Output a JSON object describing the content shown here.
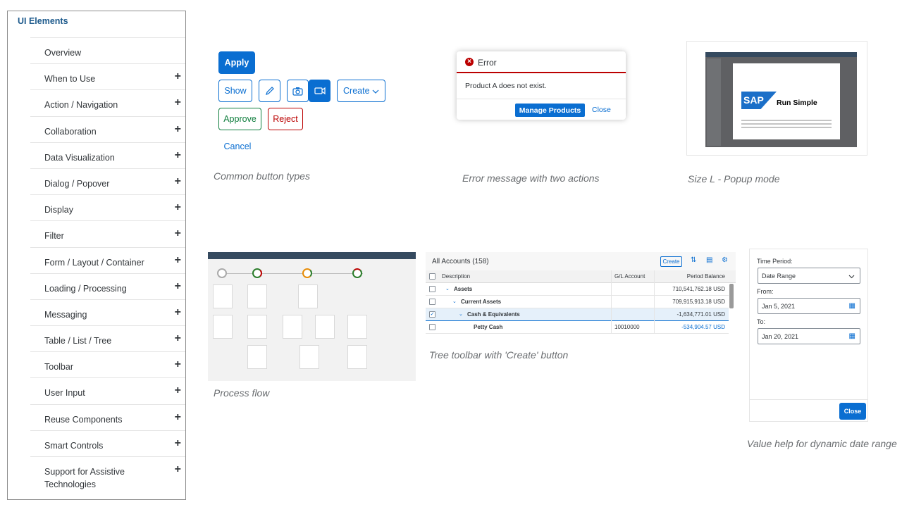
{
  "sidebar": {
    "title": "UI Elements",
    "items": [
      {
        "label": "Overview",
        "expandable": false
      },
      {
        "label": "When to Use",
        "expandable": true
      },
      {
        "label": "Action / Navigation",
        "expandable": true
      },
      {
        "label": "Collaboration",
        "expandable": true
      },
      {
        "label": "Data Visualization",
        "expandable": true
      },
      {
        "label": "Dialog / Popover",
        "expandable": true
      },
      {
        "label": "Display",
        "expandable": true
      },
      {
        "label": "Filter",
        "expandable": true
      },
      {
        "label": "Form / Layout / Container",
        "expandable": true
      },
      {
        "label": "Loading / Processing",
        "expandable": true
      },
      {
        "label": "Messaging",
        "expandable": true
      },
      {
        "label": "Table / List / Tree",
        "expandable": true
      },
      {
        "label": "Toolbar",
        "expandable": true
      },
      {
        "label": "User Input",
        "expandable": true
      },
      {
        "label": "Reuse Components",
        "expandable": true
      },
      {
        "label": "Smart Controls",
        "expandable": true
      },
      {
        "label": "Support for Assistive Technologies",
        "expandable": true
      }
    ],
    "expand_glyph": "+"
  },
  "buttons_demo": {
    "apply": "Apply",
    "show": "Show",
    "create": "Create",
    "approve": "Approve",
    "reject": "Reject",
    "cancel": "Cancel",
    "caption": "Common button types"
  },
  "error_demo": {
    "title": "Error",
    "icon": "error-icon",
    "message": "Product A does not exist.",
    "primary_action": "Manage Products",
    "secondary_action": "Close",
    "caption": "Error message with two actions"
  },
  "popup_demo": {
    "logo_text": "SAP",
    "tagline": "Run Simple",
    "caption": "Size L - Popup mode"
  },
  "process_flow_demo": {
    "caption": "Process flow"
  },
  "tree_demo": {
    "title": "All Accounts (158)",
    "create_label": "Create",
    "columns": [
      "Description",
      "G/L Account",
      "Period Balance"
    ],
    "rows": [
      {
        "description": "Assets",
        "account": "",
        "balance": "710,541,762.18 USD",
        "checked": false,
        "selected": false
      },
      {
        "description": "Current Assets",
        "account": "",
        "balance": "709,915,913.18 USD",
        "checked": false,
        "selected": false
      },
      {
        "description": "Cash & Equivalents",
        "account": "",
        "balance": "-1,634,771.01 USD",
        "checked": true,
        "selected": true
      },
      {
        "description": "Petty Cash",
        "account": "10010000",
        "balance": "-534,904.57 USD",
        "checked": false,
        "selected": false
      }
    ],
    "caption": "Tree toolbar with 'Create' button"
  },
  "date_range_demo": {
    "time_period_label": "Time Period:",
    "time_period_value": "Date Range",
    "from_label": "From:",
    "from_value": "Jan 5, 2021",
    "to_label": "To:",
    "to_value": "Jan 20, 2021",
    "close_label": "Close",
    "caption": "Value help for dynamic date range"
  }
}
